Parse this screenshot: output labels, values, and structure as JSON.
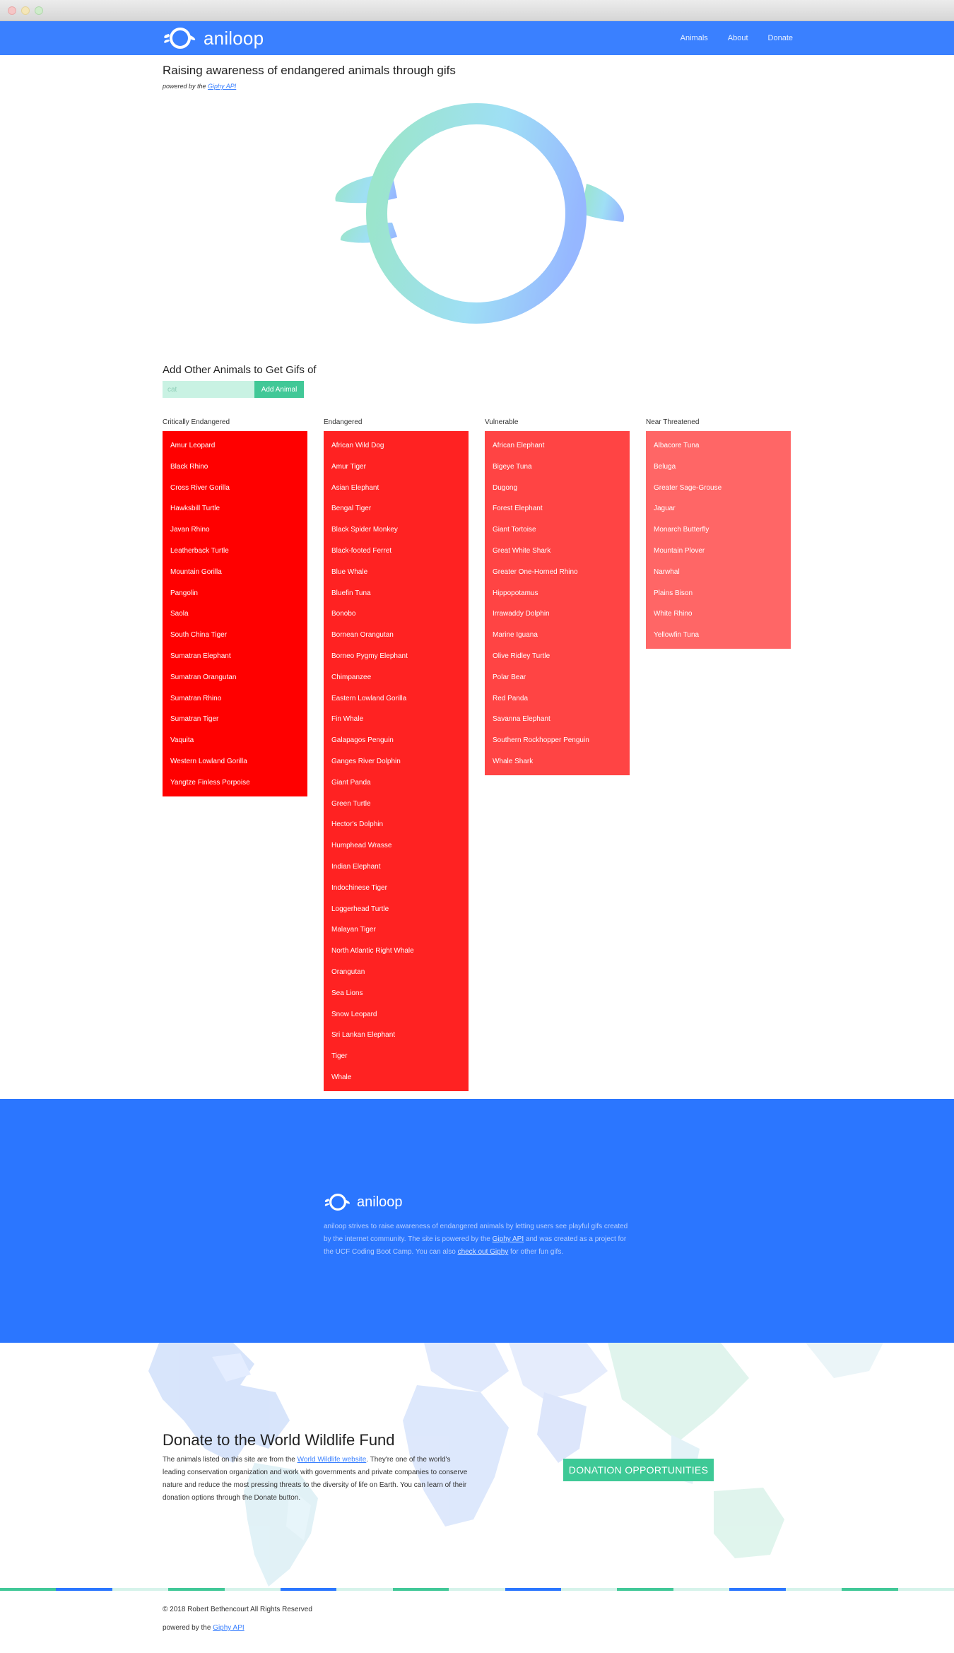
{
  "nav": {
    "brand": "aniloop",
    "links": [
      "Animals",
      "About",
      "Donate"
    ]
  },
  "hero": {
    "headline": "Raising awareness of endangered animals through gifs",
    "powered_prefix": "powered by the ",
    "powered_link": "Giphy API"
  },
  "add": {
    "title": "Add Other Animals to Get Gifs of",
    "placeholder": "cat",
    "button": "Add Animal"
  },
  "columns": [
    {
      "title": "Critically Endangered",
      "color": "#ff0000",
      "items": [
        "Amur Leopard",
        "Black Rhino",
        "Cross River Gorilla",
        "Hawksbill Turtle",
        "Javan Rhino",
        "Leatherback Turtle",
        "Mountain Gorilla",
        "Pangolin",
        "Saola",
        "South China Tiger",
        "Sumatran Elephant",
        "Sumatran Orangutan",
        "Sumatran Rhino",
        "Sumatran Tiger",
        "Vaquita",
        "Western Lowland Gorilla",
        "Yangtze Finless Porpoise"
      ]
    },
    {
      "title": "Endangered",
      "color": "#ff2222",
      "items": [
        "African Wild Dog",
        "Amur Tiger",
        "Asian Elephant",
        "Bengal Tiger",
        "Black Spider Monkey",
        "Black-footed Ferret",
        "Blue Whale",
        "Bluefin Tuna",
        "Bonobo",
        "Bornean Orangutan",
        "Borneo Pygmy Elephant",
        "Chimpanzee",
        "Eastern Lowland Gorilla",
        "Fin Whale",
        "Galapagos Penguin",
        "Ganges River Dolphin",
        "Giant Panda",
        "Green Turtle",
        "Hector's Dolphin",
        "Humphead Wrasse",
        "Indian Elephant",
        "Indochinese Tiger",
        "Loggerhead Turtle",
        "Malayan Tiger",
        "North Atlantic Right Whale",
        "Orangutan",
        "Sea Lions",
        "Snow Leopard",
        "Sri Lankan Elephant",
        "Tiger",
        "Whale"
      ]
    },
    {
      "title": "Vulnerable",
      "color": "#ff4444",
      "items": [
        "African Elephant",
        "Bigeye Tuna",
        "Dugong",
        "Forest Elephant",
        "Giant Tortoise",
        "Great White Shark",
        "Greater One-Horned Rhino",
        "Hippopotamus",
        "Irrawaddy Dolphin",
        "Marine Iguana",
        "Olive Ridley Turtle",
        "Polar Bear",
        "Red Panda",
        "Savanna Elephant",
        "Southern Rockhopper Penguin",
        "Whale Shark"
      ]
    },
    {
      "title": "Near Threatened",
      "color": "#ff6666",
      "items": [
        "Albacore Tuna",
        "Beluga",
        "Greater Sage-Grouse",
        "Jaguar",
        "Monarch Butterfly",
        "Mountain Plover",
        "Narwhal",
        "Plains Bison",
        "White Rhino",
        "Yellowfin Tuna"
      ]
    }
  ],
  "footer": {
    "brand": "aniloop",
    "desc_1": "aniloop strives to raise awareness of endangered animals by letting users see playful gifs created by the internet community. The site is powered by the ",
    "desc_link_1": "Giphy API",
    "desc_2": " and was created as a project for the UCF Coding Boot Camp. You can also ",
    "desc_link_2": "check out Giphy",
    "desc_3": " for other fun gifs."
  },
  "donate": {
    "title": "Donate to the World Wildlife Fund",
    "text_1": "The animals listed on this site are from the ",
    "text_link": "World Wildlife website",
    "text_2": ". They're one of the world's leading conservation organization and work with governments and private companies to conserve nature and reduce the most pressing threats to the diversity of life on Earth. You can learn of their donation options through the Donate button.",
    "button": "DONATION OPPORTUNITIES"
  },
  "bottom": {
    "copyright": "© 2018 Robert Bethencourt All Rights Reserved",
    "powered_prefix": "powered by the ",
    "powered_link": "Giphy API"
  },
  "colors": {
    "nav_blue": "#3a80ff",
    "footer_blue": "#2b76ff",
    "accent_green": "#41c897",
    "stripe": [
      "#41c897",
      "#2b76ff",
      "#d6f3ea",
      "#41c897",
      "#d6f3ea",
      "#2b76ff",
      "#d6f3ea",
      "#41c897",
      "#d6f3ea",
      "#2b76ff",
      "#d6f3ea",
      "#41c897",
      "#d6f3ea",
      "#2b76ff",
      "#d6f3ea",
      "#41c897",
      "#d6f3ea"
    ]
  },
  "icons": {
    "brand_logo": "aniloop-loop-icon",
    "hero_logo": "aniloop-large-logo-icon"
  }
}
